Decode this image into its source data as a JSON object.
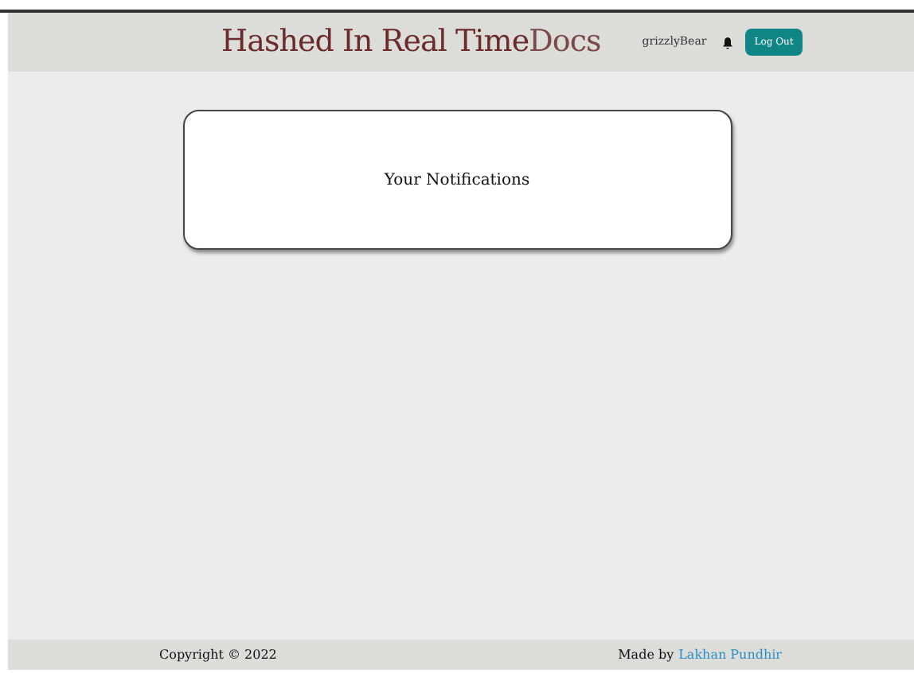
{
  "header": {
    "title_main": "Hashed In Real Time",
    "title_suffix": "Docs",
    "username": "grizzlyBear",
    "logout_button": "Log Out"
  },
  "notifications_card": {
    "heading": "Your Notifications"
  },
  "footer": {
    "copyright": "Copyright © 2022",
    "made_by": "Made by",
    "author_link": "Lakhan Pundhir"
  }
}
